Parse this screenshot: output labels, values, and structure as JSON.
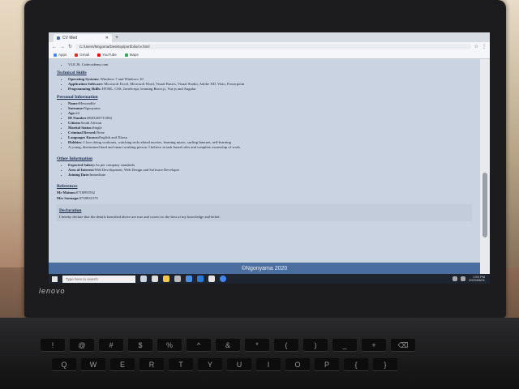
{
  "device": {
    "brand": "lenovo"
  },
  "browser": {
    "tab_title": "CV Med",
    "address": "C:/Users/Mngoma/Desktop/portfolio/cv.html",
    "bookmarks": [
      "Apps",
      "Gmail",
      "YouTube",
      "Maps"
    ]
  },
  "page": {
    "top_item": "VLE.JS, Codecademy.com",
    "technical": {
      "heading": "Technical Skills",
      "items": [
        {
          "label": "Operating Systems:",
          "value": " Windows 7 and Windows 10"
        },
        {
          "label": "Application Software:",
          "value": " Microsoft Excel, Microsoft Word, Visual Basics, Visual Studio, Adobe XD, Visio, Powerpoint"
        },
        {
          "label": "Programming Skills:",
          "value": " HTML, CSS, JavaScript, learning React.js, Vue.js and Angular"
        }
      ]
    },
    "personal": {
      "heading": "Personal Information",
      "items": [
        {
          "label": "Name:",
          "value": "Mzwandile"
        },
        {
          "label": "Surname:",
          "value": "Ngonyama"
        },
        {
          "label": "Age:",
          "value": "24"
        },
        {
          "label": "ID Number:",
          "value": "9603265711084"
        },
        {
          "label": "Citizen:",
          "value": "South African"
        },
        {
          "label": "Marital Status:",
          "value": "Single"
        },
        {
          "label": "Criminal Record:",
          "value": "None"
        },
        {
          "label": "Languages Known:",
          "value": "English and Xhosa"
        },
        {
          "label": "Hobbies:",
          "value": " I love doing workouts, watching tech related movies, learning music, surfing Internet, self-learning"
        }
      ],
      "summary": "A young, determined hard and smart working person. I believe in task based roles and complete ownership of work."
    },
    "other": {
      "heading": "Other Information",
      "items": [
        {
          "label": "Expected Salary:",
          "value": "As per company standards"
        },
        {
          "label": "Area of Interest:",
          "value": "Web Development, Web Design and Software Developer"
        },
        {
          "label": "Joining Date:",
          "value": "Immediate"
        }
      ]
    },
    "references": {
      "heading": "References",
      "items": [
        {
          "label": "Mr Mainoo:",
          "value": "0718891932"
        },
        {
          "label": "Mrs Sonnago:",
          "value": "0738931579"
        }
      ]
    },
    "declaration": {
      "heading": "Declaration",
      "text": "I hereby declare that the details furnished above are true and correct to the best of my knowledge and belief."
    },
    "footer": "©Ngonyama 2020"
  },
  "taskbar": {
    "search_placeholder": "Type here to search",
    "time": "1:53 PM",
    "date": "2020/08/01"
  }
}
